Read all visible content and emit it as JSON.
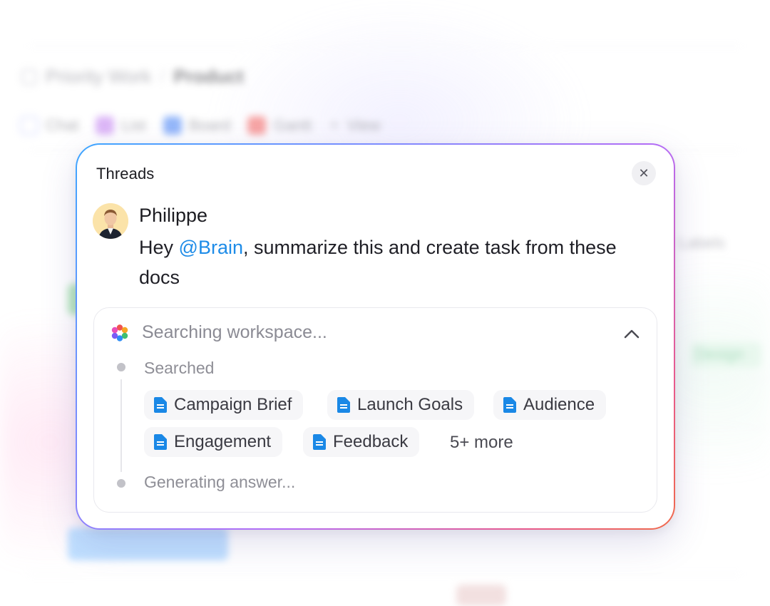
{
  "background": {
    "breadcrumb": {
      "parent": "Priority Work",
      "separator": "/",
      "current": "Product"
    },
    "view_tabs": [
      {
        "label": "Chat",
        "color": "#8f9bff"
      },
      {
        "label": "List",
        "color": "#c07cf0"
      },
      {
        "label": "Board",
        "color": "#3d7cf5"
      },
      {
        "label": "Gantt",
        "color": "#f05a5a"
      }
    ],
    "add_view_label": "View",
    "column_hint": "Labels",
    "status_hint": "Design"
  },
  "threads": {
    "title": "Threads",
    "close_icon": "close-icon",
    "message": {
      "author": "Philippe",
      "text_before": "Hey ",
      "mention": "@Brain",
      "text_after": ", summarize this and create task from these docs"
    },
    "search": {
      "status": "Searching workspace...",
      "collapse_icon": "chevron-up-icon",
      "step_searched": "Searched",
      "docs": [
        "Campaign Brief",
        "Launch Goals",
        "Audience",
        "Engagement",
        "Feedback"
      ],
      "more": "5+ more",
      "step_generating": "Generating answer..."
    },
    "colors": {
      "mention": "#1e8ce8",
      "doc_icon": "#1a88e6",
      "gradient": [
        "#3ea6ff",
        "#b56cf5",
        "#f06a4a"
      ]
    }
  }
}
